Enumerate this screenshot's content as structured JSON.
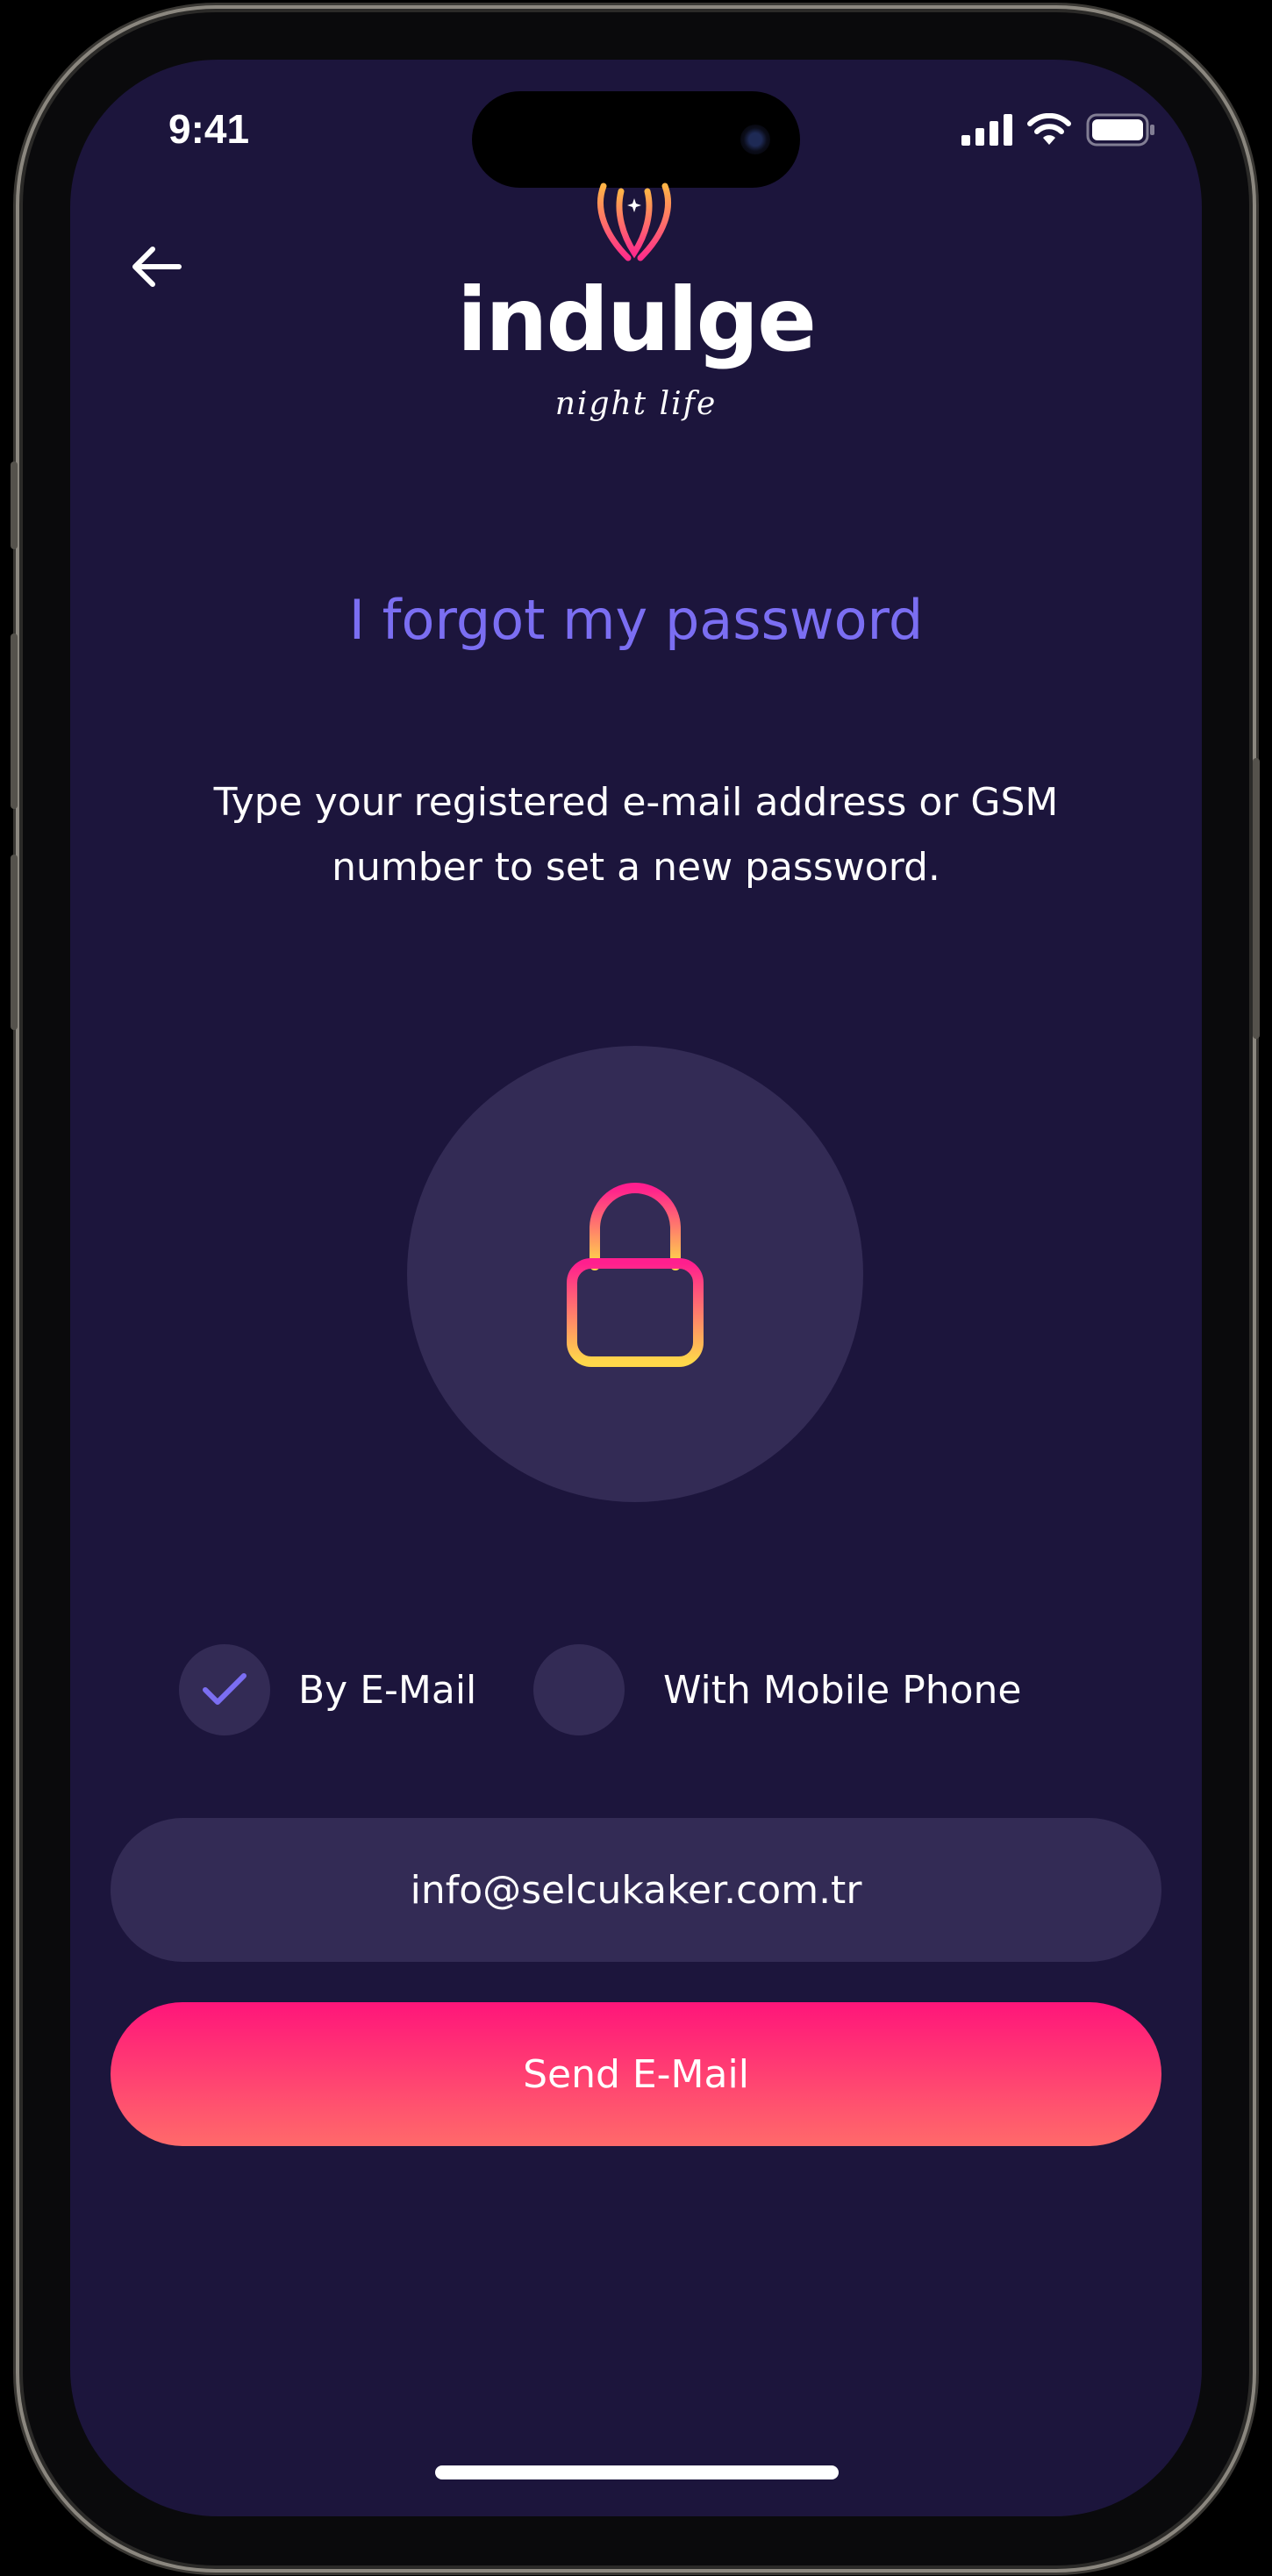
{
  "status_bar": {
    "time": "9:41",
    "icons": [
      "signal-icon",
      "wifi-icon",
      "battery-icon"
    ]
  },
  "header": {
    "back_icon": "arrow-left-icon",
    "logo_word": "indulge",
    "logo_tagline": "night life"
  },
  "page": {
    "title": "I forgot my password",
    "subtitle": "Type your registered e-mail address or GSM number to set a new password.",
    "lock_icon": "lock-icon"
  },
  "options": [
    {
      "label": "By E-Mail",
      "selected": true
    },
    {
      "label": "With Mobile Phone",
      "selected": false
    }
  ],
  "form": {
    "email_value": "info@selcukaker.com.tr",
    "submit_label": "Send E-Mail"
  },
  "colors": {
    "background": "#1c153c",
    "surface": "#332b55",
    "accent": "#7b6ef2",
    "button_gradient_top": "#ff157a",
    "button_gradient_bottom": "#ff6a6a",
    "lock_gradient_top": "#ff1f8e",
    "lock_gradient_bottom": "#ffd84a"
  }
}
